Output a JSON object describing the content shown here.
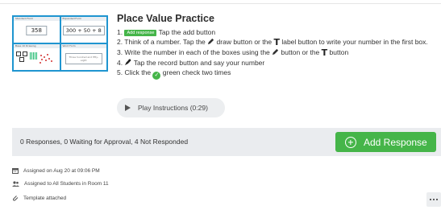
{
  "activity": {
    "title": "Place Value Practice",
    "thumbnail": {
      "headers": [
        "Standard Form",
        "Expanded Form",
        "Base 10 Drawing",
        "Word Form"
      ],
      "standard_value": "358",
      "expanded_value": "300 + 50 + 8",
      "word_form_hint": "Three hundred and fifty-eight"
    },
    "steps": {
      "s1_num": "1.",
      "s1_tag": "Add response",
      "s1_text": "Tap the add button",
      "s2_a": "2. Think of a number. Tap the",
      "s2_b": "draw button or the",
      "s2_c": "label button to write your number in the first box.",
      "s3_a": "3. Write the number in each of the boxes using the",
      "s3_b": "button or the",
      "s3_c": "button",
      "s4_num": "4.",
      "s4_text": "Tap the record button and say your number",
      "s5_a": "5. Click the",
      "s5_b": "green check two times",
      "label_glyph": "T",
      "check_glyph": "✓"
    },
    "play_label": "Play Instructions (0:29)"
  },
  "responses": {
    "summary": "0 Responses, 0 Waiting for Approval, 4 Not Responded",
    "add_label": "Add Response"
  },
  "meta": {
    "assigned_on": "Assigned on Aug 20 at 09:06 PM",
    "assigned_to": "Assigned to All Students in Room 11",
    "template": "Template attached"
  },
  "icons": [
    "play-icon",
    "plus-circle-icon",
    "calendar-icon",
    "people-icon",
    "paperclip-icon",
    "pencil-icon",
    "microphone-icon",
    "check-icon",
    "more-icon"
  ],
  "colors": {
    "accent_green": "#45b549",
    "thumb_blue": "#1f95d0",
    "panel_gray": "#eaecef"
  }
}
